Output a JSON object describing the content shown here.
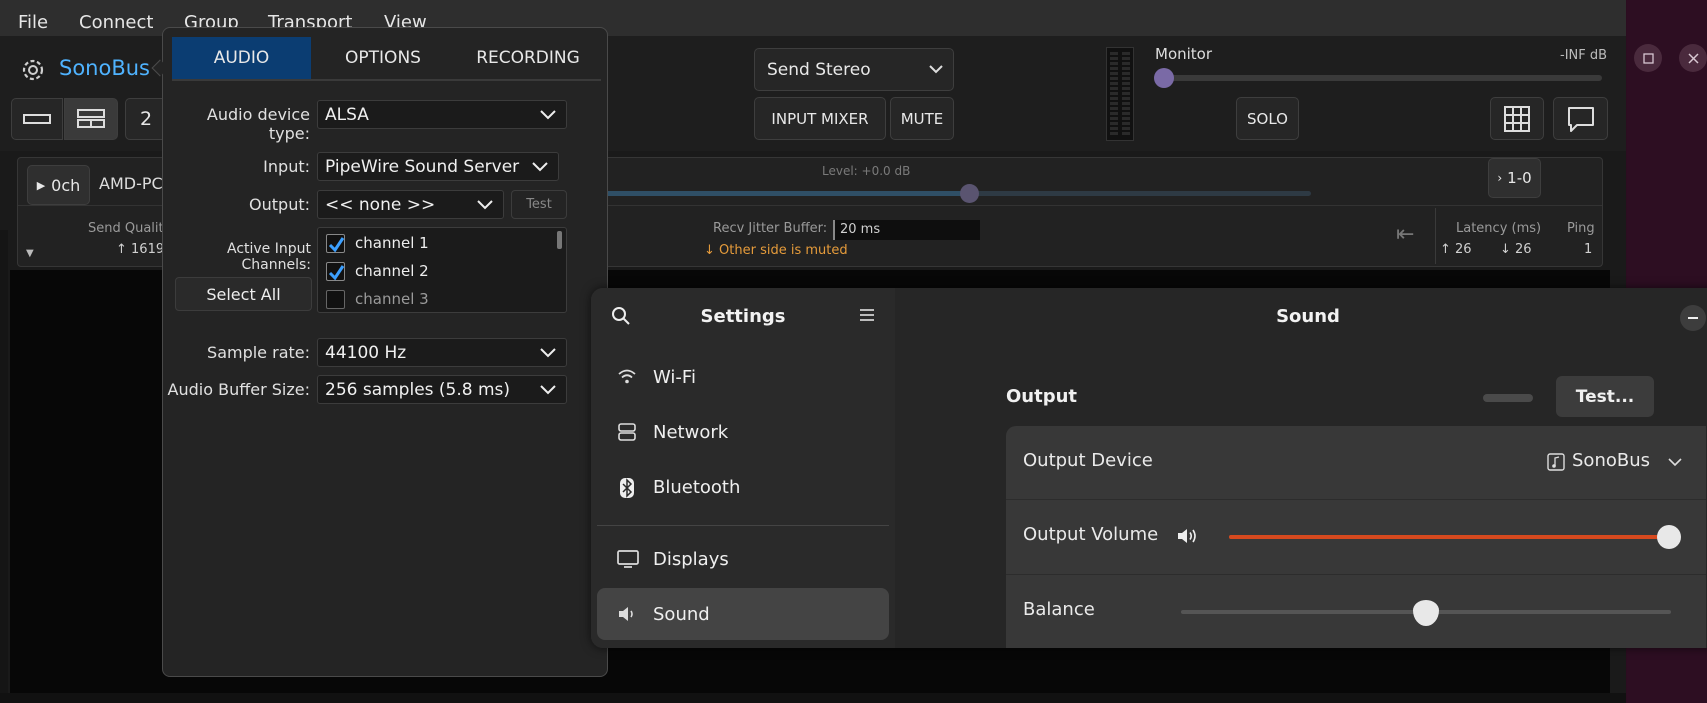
{
  "menubar": {
    "items": [
      "File",
      "Connect",
      "Group",
      "Transport",
      "View"
    ]
  },
  "sonobus": {
    "title": "SonoBus",
    "count_label": "2",
    "send_mode": "Send Stereo",
    "input_mixer_label": "INPUT MIXER",
    "mute_label": "MUTE",
    "monitor_label": "Monitor",
    "monitor_db": "-INF dB",
    "monitor_level": 0,
    "solo_label": "SOLO",
    "peer": {
      "channels_label": "0ch",
      "name": "AMD-PC",
      "level_text": "Level: +0.0 dB",
      "level_fraction": 0.6,
      "route_label": "1-0",
      "send_quality_label": "Send Quality",
      "send_quality_value": "1619",
      "jitter_label": "Recv Jitter Buffer:",
      "jitter_value": "20 ms",
      "muted_notice": "Other side is muted",
      "latency_label": "Latency (ms)",
      "latency_up": "26",
      "latency_down": "26",
      "ping_label": "Ping",
      "ping_value": "1"
    }
  },
  "audio_popup": {
    "tabs": [
      "AUDIO",
      "OPTIONS",
      "RECORDING"
    ],
    "active_tab": "AUDIO",
    "device_type_label": "Audio device type:",
    "device_type_value": "ALSA",
    "input_label": "Input:",
    "input_value": "PipeWire Sound Server",
    "output_label": "Output:",
    "output_value": "<< none >>",
    "test_label": "Test",
    "active_channels_label": "Active Input Channels:",
    "channels": [
      {
        "name": "channel 1",
        "checked": true
      },
      {
        "name": "channel 2",
        "checked": true
      },
      {
        "name": "channel 3",
        "checked": false
      }
    ],
    "select_all_label": "Select All",
    "sample_rate_label": "Sample rate:",
    "sample_rate_value": "44100 Hz",
    "buffer_label": "Audio Buffer Size:",
    "buffer_value": "256 samples (5.8 ms)"
  },
  "settings": {
    "sidebar_title": "Settings",
    "page_title": "Sound",
    "sidebar_items": [
      {
        "label": "Wi-Fi",
        "icon": "wifi-icon"
      },
      {
        "label": "Network",
        "icon": "network-icon"
      },
      {
        "label": "Bluetooth",
        "icon": "bluetooth-icon"
      },
      {
        "label": "Displays",
        "icon": "display-icon"
      },
      {
        "label": "Sound",
        "icon": "speaker-icon",
        "active": true
      }
    ],
    "output_heading": "Output",
    "test_button": "Test...",
    "output_device_label": "Output Device",
    "output_device_value": "SonoBus",
    "output_volume_label": "Output Volume",
    "output_volume_level": 1.0,
    "balance_label": "Balance",
    "balance_level": 0.5
  },
  "colors": {
    "accent_blue": "#4fb3ff",
    "tab_active": "#0b3d72",
    "muted_orange": "#e59b3b",
    "volume_orange": "#d6491e",
    "check_blue": "#3ca0ff"
  }
}
